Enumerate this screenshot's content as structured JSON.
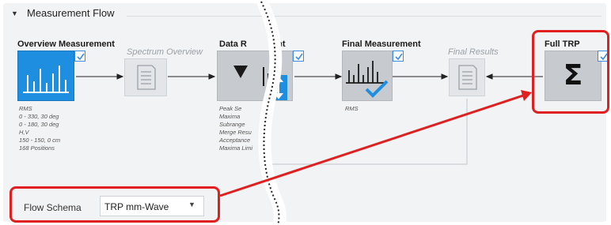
{
  "header": {
    "toggle": "▼",
    "title": "Measurement Flow"
  },
  "nodes": {
    "overview": {
      "title": "Overview Measurement",
      "info": [
        "RMS",
        "0 - 330, 30 deg",
        "0 - 180, 30 deg",
        "H,V",
        "150 - 150, 0 cm",
        "168 Positions"
      ]
    },
    "spectrum": {
      "title": "Spectrum Overview"
    },
    "data_reduction": {
      "title": "Data R",
      "title_tail": "ent",
      "info": [
        "Peak Se",
        "Maxima",
        "Subrange",
        "Merge Resu",
        "Acceptance",
        "Maxima Limi"
      ]
    },
    "final": {
      "title": "Final Measurement",
      "info": [
        "RMS"
      ]
    },
    "final_results": {
      "title": "Final Results"
    },
    "full_trp": {
      "title": "Full TRP",
      "symbol": "Σ"
    }
  },
  "schema": {
    "label": "Flow Schema",
    "value": "TRP mm-Wave"
  },
  "colors": {
    "highlight": "#e02020",
    "blue_node": "#1e8fe0",
    "check": "#3c8ce0"
  }
}
